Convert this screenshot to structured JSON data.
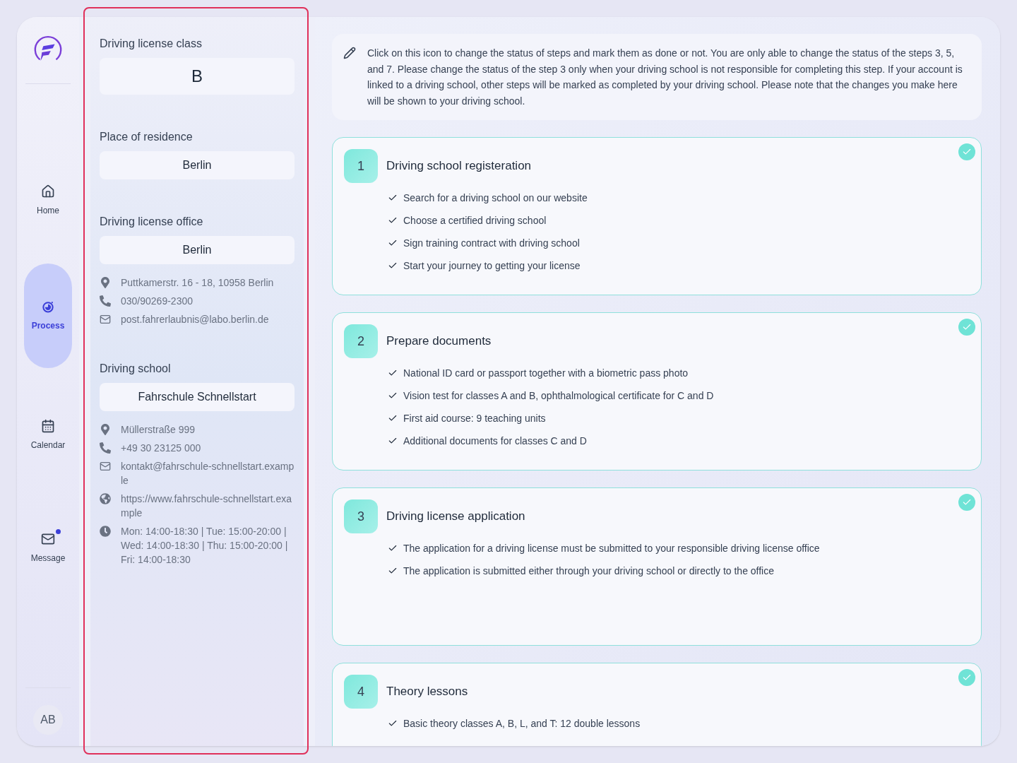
{
  "nav": {
    "items": [
      {
        "label": "Home",
        "kind": "home",
        "selected": false,
        "unread": false
      },
      {
        "label": "Process",
        "kind": "process",
        "selected": true,
        "unread": false
      },
      {
        "label": "Calendar",
        "kind": "calendar",
        "selected": false,
        "unread": false
      },
      {
        "label": "Message",
        "kind": "message",
        "selected": false,
        "unread": true
      }
    ],
    "avatar": "AB"
  },
  "details": {
    "sections": [
      {
        "label": "Driving license class",
        "value": "B",
        "kind": "large"
      },
      {
        "label": "Place of residence",
        "value": "Berlin",
        "kind": "plain"
      },
      {
        "label": "Driving license office",
        "value": "Berlin",
        "kind": "plain",
        "contacts": [
          {
            "kind": "address",
            "text": "Puttkamerstr. 16 - 18, 10958 Berlin"
          },
          {
            "kind": "phone",
            "text": "030/90269-2300"
          },
          {
            "kind": "email",
            "text": "post.fahrerlaubnis@labo.berlin.de"
          }
        ]
      },
      {
        "label": "Driving school",
        "value": "Fahrschule Schnellstart",
        "kind": "plain",
        "contacts": [
          {
            "kind": "address",
            "text": "Müllerstraße 999"
          },
          {
            "kind": "phone",
            "text": "+49 30 23125 000"
          },
          {
            "kind": "email",
            "text": "kontakt@fahrschule-schnellstart.example"
          },
          {
            "kind": "website",
            "text": "https://www.fahrschule-schnellstart.example"
          },
          {
            "kind": "hours",
            "text": "Mon: 14:00-18:30 | Tue: 15:00-20:00 | Wed: 14:00-18:30 | Thu: 15:00-20:00 | Fri: 14:00-18:30"
          }
        ]
      }
    ]
  },
  "notice": "Click on this icon to change the status of steps and mark them as done or not. You are only able to change the status of the steps 3, 5, and 7. Please change the status of the step 3 only when your driving school is not responsible for completing this step. If your account is linked to a driving school, other steps will be marked as completed by your driving school. Please note that the changes you make here will be shown to your driving school.",
  "steps": [
    {
      "number": "1",
      "title": "Driving school registeration",
      "done": true,
      "items": [
        "Search for a driving school on our website",
        "Choose a certified driving school",
        "Sign training contract with driving school",
        "Start your journey to getting your license"
      ]
    },
    {
      "number": "2",
      "title": "Prepare documents",
      "done": true,
      "items": [
        "National ID card or passport together with a biometric pass photo",
        "Vision test for classes A and B, ophthalmological certificate for C and D",
        "First aid course: 9 teaching units",
        "Additional documents for classes C and D"
      ]
    },
    {
      "number": "3",
      "title": "Driving license application",
      "done": true,
      "items": [
        "The application for a driving license must be submitted to your responsible driving license office",
        "The application is submitted either through your driving school or directly to the office"
      ]
    },
    {
      "number": "4",
      "title": "Theory lessons",
      "done": true,
      "items": [
        "Basic theory classes A, B, L, and T: 12 double lessons"
      ]
    }
  ]
}
